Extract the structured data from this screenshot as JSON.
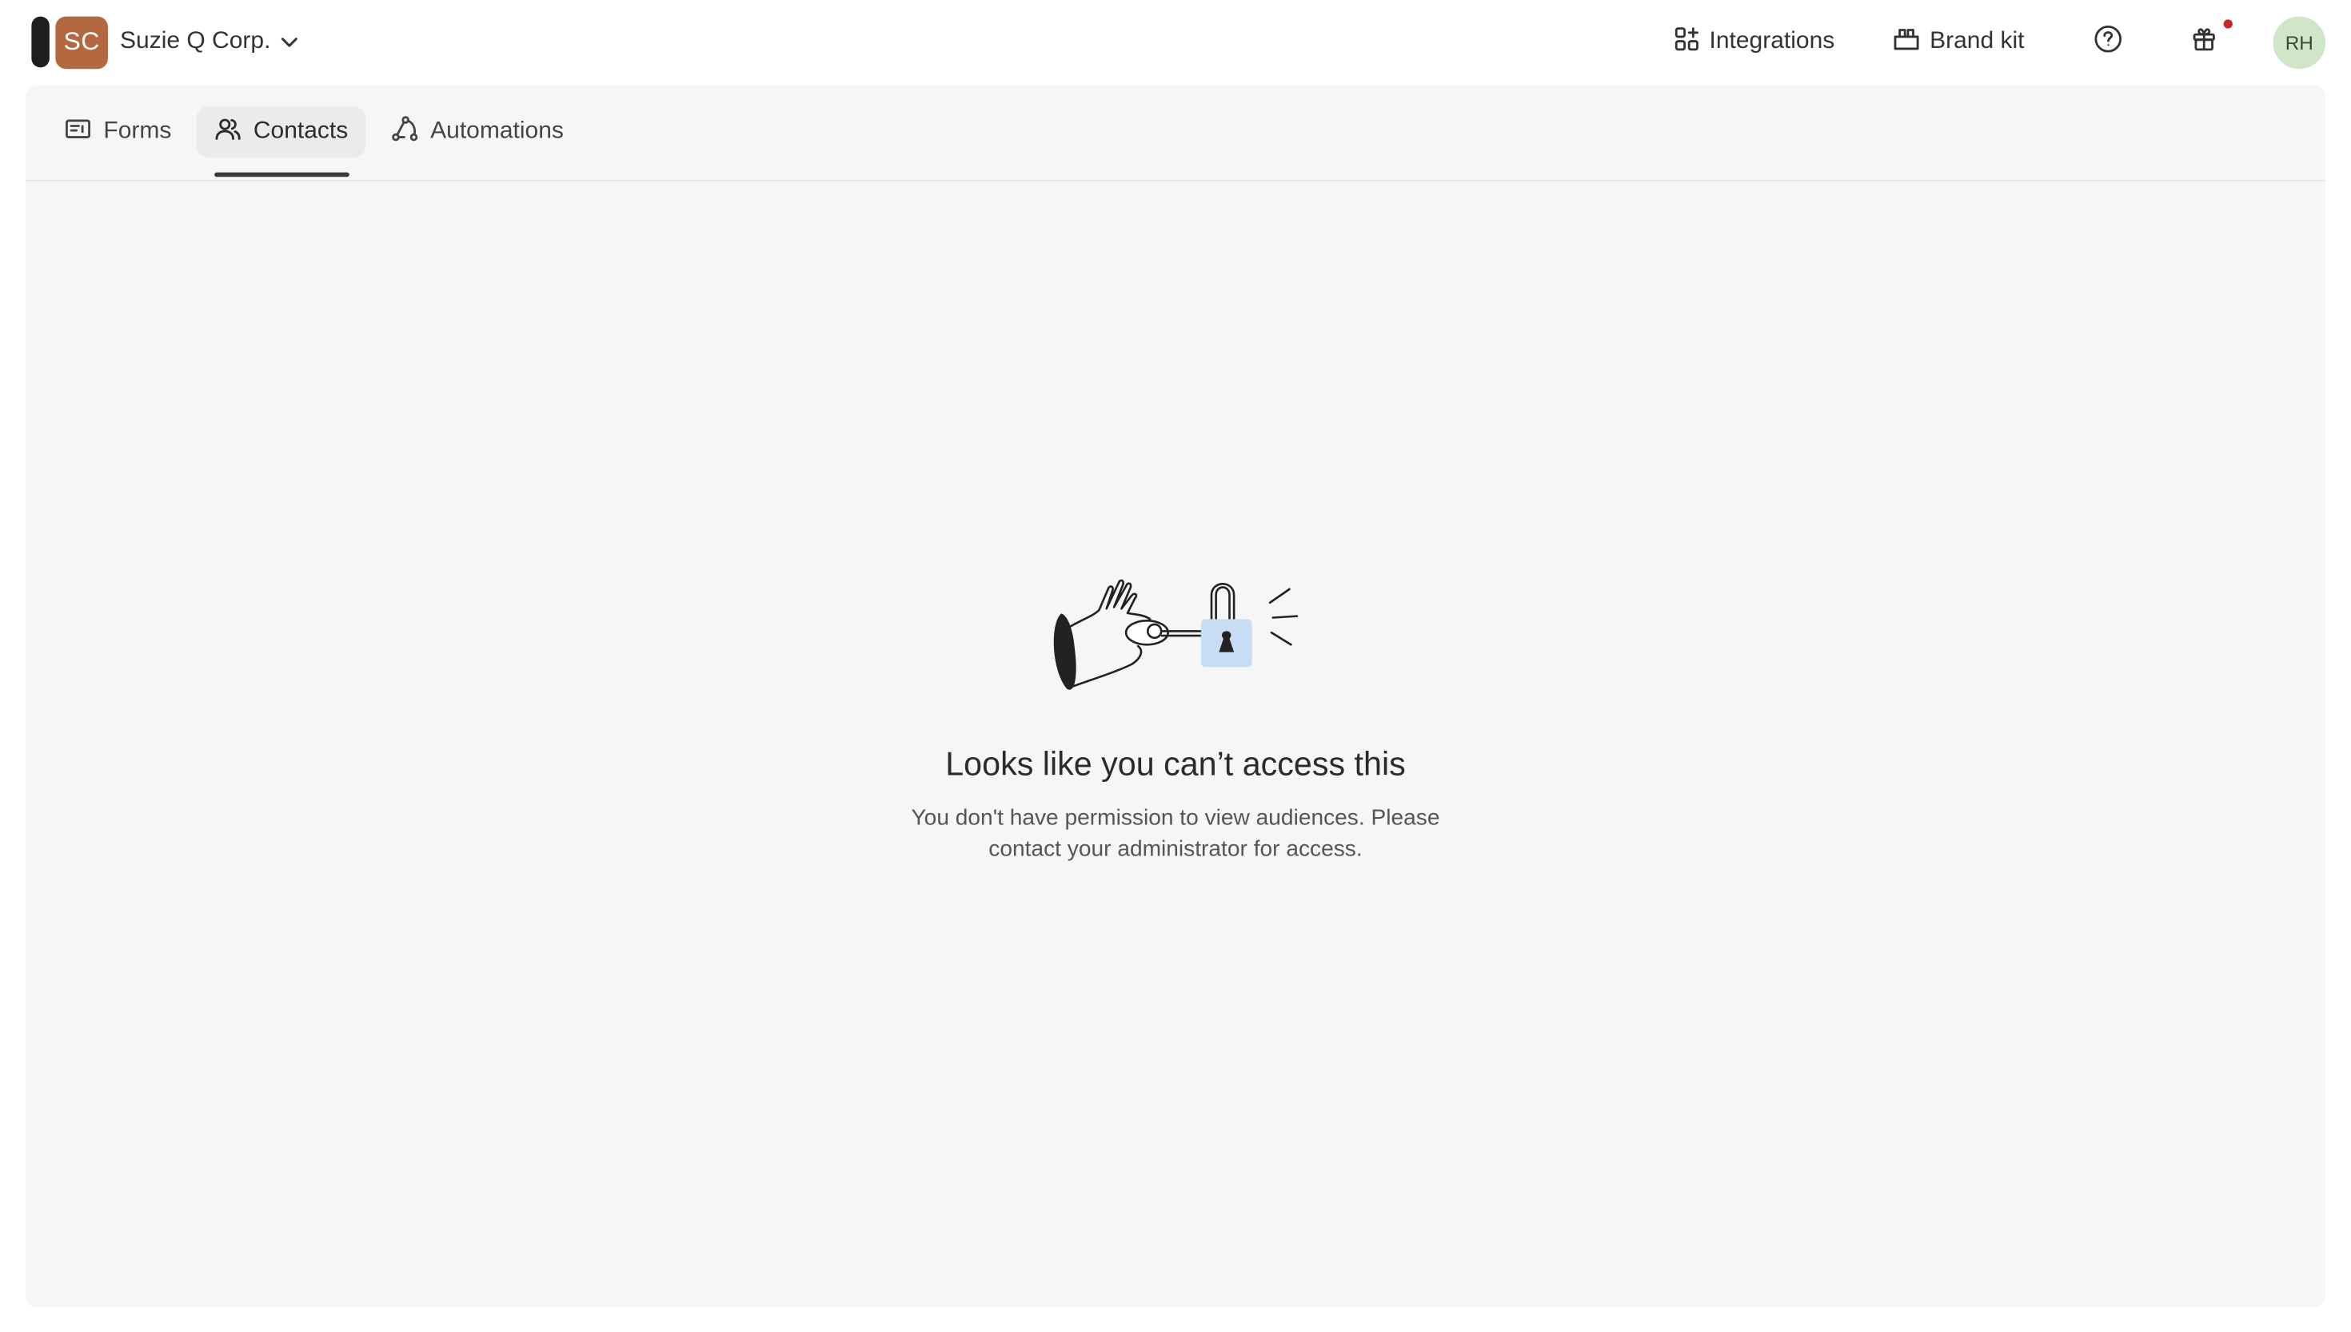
{
  "workspace": {
    "initials": "SC",
    "name": "Suzie Q Corp.",
    "avatar_color": "#b4683f"
  },
  "header": {
    "integrations_label": "Integrations",
    "brand_kit_label": "Brand kit",
    "help_icon": "help-circle-icon",
    "gift_icon": "gift-icon",
    "has_notification": true,
    "user_initials": "RH",
    "user_avatar_color": "#cfe6c8"
  },
  "tabs": [
    {
      "label": "Forms",
      "icon": "form-icon",
      "active": false
    },
    {
      "label": "Contacts",
      "icon": "contacts-icon",
      "active": true
    },
    {
      "label": "Automations",
      "icon": "automations-icon",
      "active": false
    }
  ],
  "empty_state": {
    "illustration": "hand-key-padlock-illustration",
    "title": "Looks like you can’t access this",
    "description": "You don't have permission to view audiences. Please contact your administrator for access."
  },
  "colors": {
    "panel_background": "#f6f6f6",
    "lock_fill": "#c8dcf4",
    "notification_dot": "#c8262a"
  }
}
